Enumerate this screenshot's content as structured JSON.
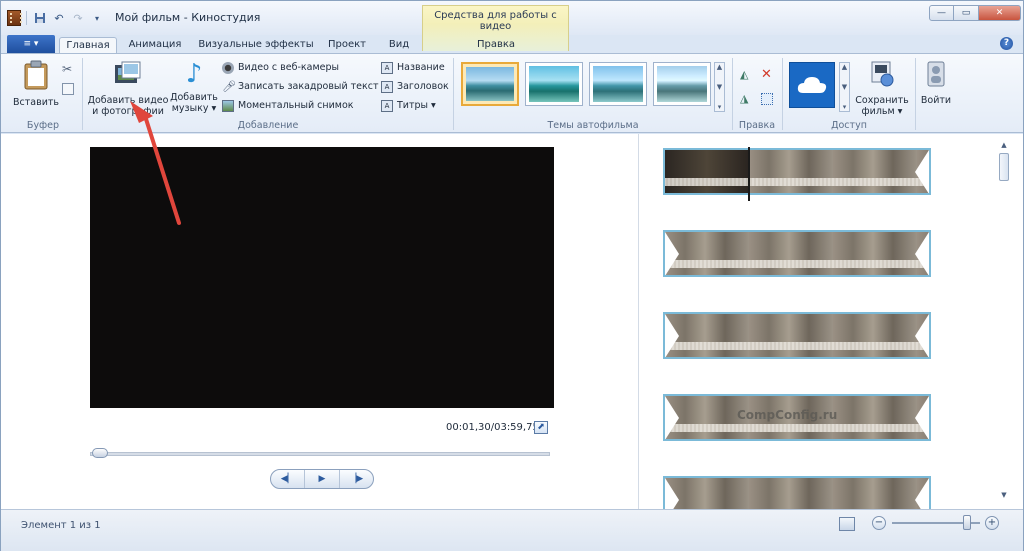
{
  "window": {
    "title": "Мой фильм - Киностудия",
    "context_tools": "Средства для работы с видео"
  },
  "tabs": [
    "Главная",
    "Анимация",
    "Визуальные эффекты",
    "Проект",
    "Вид",
    "Правка"
  ],
  "ribbon": {
    "clipboard": {
      "paste": "Вставить",
      "group": "Буфер"
    },
    "add": {
      "add_video_line1": "Добавить видео",
      "add_video_line2": "и фотографии",
      "add_music_line1": "Добавить",
      "add_music_line2": "музыку ▾",
      "webcam": "Видео с веб-камеры",
      "narration": "Записать закадровый текст ▾",
      "snapshot": "Моментальный снимок",
      "title": "Название",
      "caption": "Заголовок",
      "credits": "Титры ▾",
      "group": "Добавление"
    },
    "themes": {
      "group": "Темы автофильма"
    },
    "edit": {
      "group": "Правка"
    },
    "share": {
      "save_line1": "Сохранить",
      "save_line2": "фильм ▾",
      "group": "Доступ"
    },
    "signin": "Войти"
  },
  "player": {
    "time": "00:01,30/03:59,75",
    "progress": 0.0054
  },
  "storyboard": {
    "watermark": "CompConfig.ru"
  },
  "status": {
    "text": "Элемент 1 из 1"
  },
  "colors": {
    "accent_border": "#7bbad8",
    "arrow": "#e0463c",
    "selected_theme": "#e8a93a"
  }
}
